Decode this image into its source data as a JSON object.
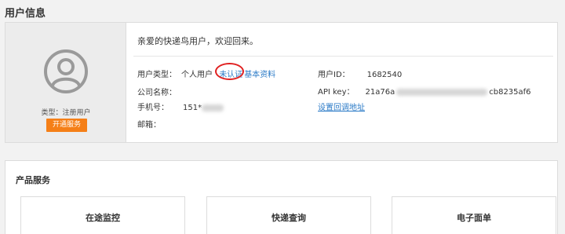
{
  "header": {
    "title": "用户信息"
  },
  "profile": {
    "user_type_caption": "类型：注册用户",
    "open_service_label": "开通服务"
  },
  "welcome_text": "亲爱的快递鸟用户，欢迎回来。",
  "fields": {
    "user_type": {
      "label": "用户类型：",
      "value": "个人用户"
    },
    "unverified_link": "未认证",
    "basic_info_link": "基本资料",
    "company": {
      "label": "公司名称："
    },
    "phone": {
      "label": "手机号：",
      "value_prefix": "151*"
    },
    "email": {
      "label": "邮箱："
    },
    "user_id": {
      "label": "用户ID：",
      "value": "1682540"
    },
    "api_key": {
      "label": "API key：",
      "value_prefix": "21a76a",
      "value_suffix": "cb8235af6"
    },
    "callback_link": "设置回调地址"
  },
  "products": {
    "title": "产品服务",
    "items": [
      {
        "label": "在途监控"
      },
      {
        "label": "快递查询"
      },
      {
        "label": "电子面单"
      }
    ]
  },
  "colors": {
    "accent_link": "#2a7ac7",
    "button_orange": "#f57f17",
    "annotation_red": "#e02020"
  }
}
